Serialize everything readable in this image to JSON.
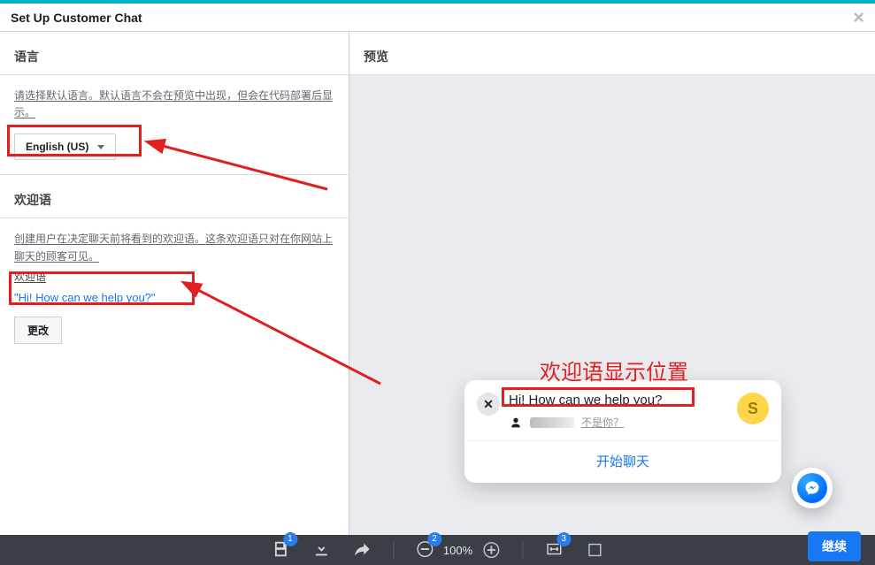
{
  "header": {
    "title": "Set Up Customer Chat"
  },
  "left": {
    "language": {
      "heading": "语言",
      "help": "请选择默认语言。默认语言不会在预览中出现，但会在代码部署后显示。",
      "selected": "English (US)"
    },
    "greeting": {
      "heading": "欢迎语",
      "help": "创建用户在决定聊天前将看到的欢迎语。这条欢迎语只对在你网站上聊天的顾客可见。",
      "label": "欢迎语",
      "value": "\"Hi! How can we help you?\"",
      "change_label": "更改"
    }
  },
  "preview": {
    "heading": "预览",
    "card": {
      "title": "Hi! How can we help you?",
      "not_you": "不是你？",
      "cta": "开始聊天",
      "avatar_letter": "S"
    }
  },
  "annotations": {
    "callout_label": "欢迎语显示位置"
  },
  "toolbar": {
    "zoom_pct": "100%",
    "badges": [
      "1",
      "2",
      "3"
    ]
  },
  "footer": {
    "continue_label": "继续"
  }
}
